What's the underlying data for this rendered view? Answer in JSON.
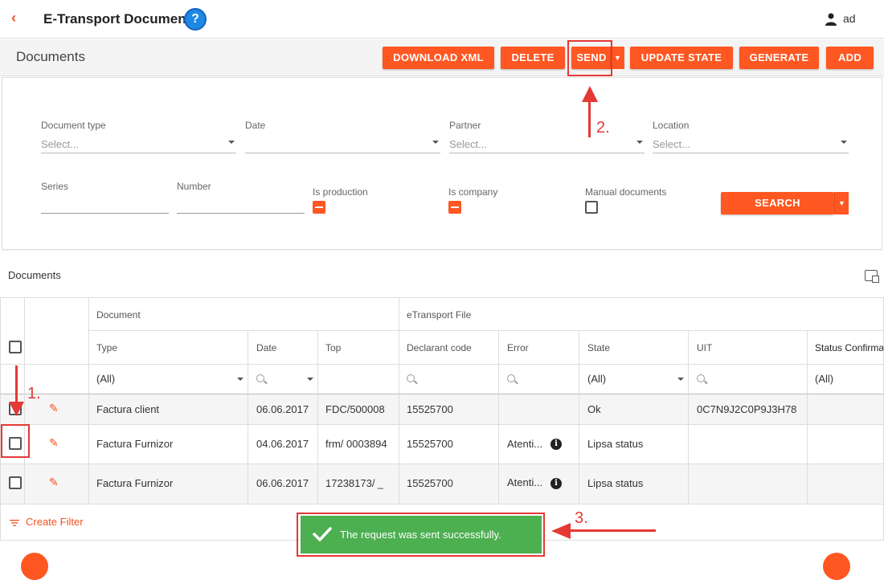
{
  "header": {
    "back_icon": "chevron-left-icon",
    "title": "E-Transport Documents",
    "help_label": "?",
    "user_icon": "user-icon",
    "user_name": "ad"
  },
  "toolbar": {
    "title": "Documents",
    "buttons": {
      "download_xml": "DOWNLOAD XML",
      "delete": "DELETE",
      "send": "SEND",
      "update_state": "UPDATE STATE",
      "generate": "GENERATE",
      "add": "ADD"
    }
  },
  "filters": {
    "document_type": {
      "label": "Document type",
      "placeholder": "Select..."
    },
    "date": {
      "label": "Date",
      "placeholder": ""
    },
    "partner": {
      "label": "Partner",
      "placeholder": "Select..."
    },
    "location": {
      "label": "Location",
      "placeholder": "Select..."
    },
    "series": {
      "label": "Series"
    },
    "number": {
      "label": "Number"
    },
    "is_production": {
      "label": "Is production",
      "state": "indeterminate"
    },
    "is_company": {
      "label": "Is company",
      "state": "indeterminate"
    },
    "manual_documents": {
      "label": "Manual documents",
      "state": "unchecked"
    },
    "search_button": "SEARCH"
  },
  "grid": {
    "caption": "Documents",
    "groups": {
      "document": "Document",
      "etransport": "eTransport File"
    },
    "columns": {
      "type": "Type",
      "date": "Date",
      "top": "Top",
      "declarant_code": "Declarant code",
      "error": "Error",
      "state": "State",
      "uit": "UIT",
      "status_confirm": "Status Confirma"
    },
    "filter_row": {
      "type": "(All)",
      "state": "(All)",
      "status_confirm": "(All)"
    },
    "rows": [
      {
        "type": "Factura client",
        "date": "06.06.2017",
        "top": "FDC/500008",
        "declarant": "15525700",
        "error": "",
        "state": "Ok",
        "uit": "0C7N9J2C0P9J3H78"
      },
      {
        "type": "Factura Furnizor",
        "date": "04.06.2017",
        "top": "frm/ 0003894",
        "declarant": "15525700",
        "error": "Atenti...",
        "state": "Lipsa status",
        "uit": ""
      },
      {
        "type": "Factura Furnizor",
        "date": "06.06.2017",
        "top": "17238173/ _",
        "declarant": "15525700",
        "error": "Atenti...",
        "state": "Lipsa status",
        "uit": ""
      }
    ],
    "create_filter": "Create Filter"
  },
  "toast": {
    "message": "The request was sent successfully.",
    "icon": "check-icon"
  },
  "annotations": {
    "step1": "1.",
    "step2": "2.",
    "step3": "3.",
    "color": "#e53935"
  },
  "colors": {
    "accent": "#ff5722",
    "toast": "#4caf50",
    "help": "#1e88e5"
  }
}
